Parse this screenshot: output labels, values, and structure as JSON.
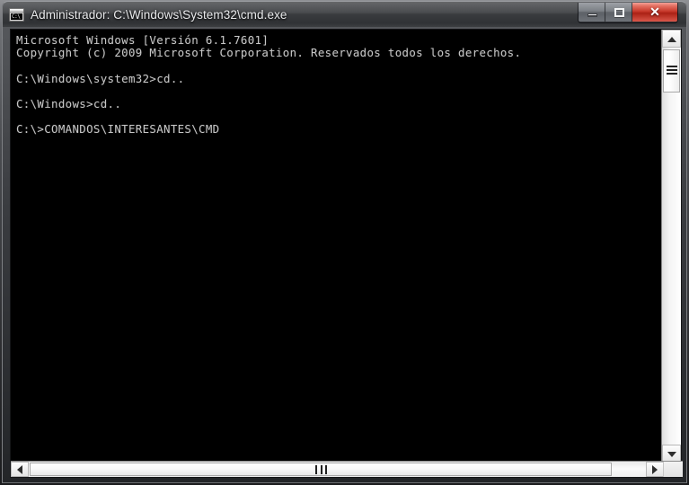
{
  "window": {
    "title": "Administrador: C:\\Windows\\System32\\cmd.exe",
    "icon_name": "cmd-console-icon",
    "icon_glyph": "C:\\",
    "controls": {
      "minimize_label": "—",
      "maximize_label": "□",
      "close_label": "✕"
    },
    "accent_close_color": "#c02a1c",
    "titlebar_color": "#3a3c3f"
  },
  "console": {
    "background_color": "#000000",
    "text_color": "#c6c6c6",
    "lines": [
      "Microsoft Windows [Versión 6.1.7601]",
      "Copyright (c) 2009 Microsoft Corporation. Reservados todos los derechos.",
      "",
      "C:\\Windows\\system32>cd..",
      "",
      "C:\\Windows>cd..",
      "",
      "C:\\>COMANDOS\\INTERESANTES\\CMD"
    ]
  },
  "scrollbars": {
    "vertical": {
      "up_label": "▲",
      "down_label": "▼",
      "thumb_grip": "grip-lines"
    },
    "horizontal": {
      "left_label": "◀",
      "right_label": "▶",
      "thumb_grip": "grip-bars"
    }
  }
}
